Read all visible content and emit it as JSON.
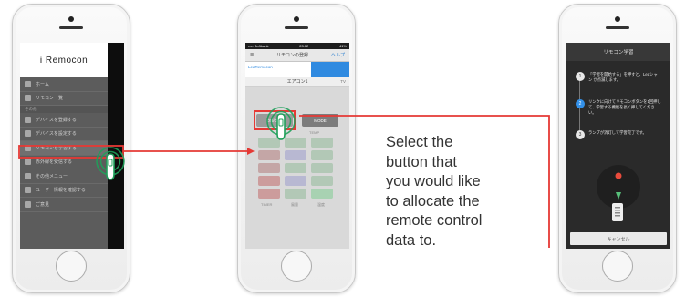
{
  "colors": {
    "arrow": "#e53935",
    "finger": "#1fa05a",
    "accent_blue": "#2f8ae0"
  },
  "phone1": {
    "app_logo": "i Remocon",
    "menu_items": [
      {
        "label": "ホーム",
        "icon": "house-icon"
      },
      {
        "label": "リモコン一覧",
        "icon": "list-icon"
      },
      {
        "label": "デバイスを登録する",
        "icon": "register-icon"
      },
      {
        "label": "デバイスを設定する",
        "icon": "settings-icon"
      },
      {
        "label": "リモコンを学習する",
        "icon": "learn-icon"
      },
      {
        "label": "赤外線を受信する",
        "icon": "receive-icon"
      },
      {
        "label": "その他メニュー",
        "icon": "search-icon"
      },
      {
        "label": "ユーザー情報を確認する",
        "icon": "user-icon"
      },
      {
        "label": "ご意見",
        "icon": "mail-icon"
      }
    ],
    "section_label": "その他"
  },
  "phone2": {
    "status_left": "•••• Softbank",
    "status_time": "23:02",
    "status_right": "41%",
    "nav_title": "リモコンの登録",
    "nav_help": "ヘルプ",
    "tab_label": "LeaRemocon",
    "device_name": "エアコン1",
    "device_type": "TV",
    "button_on": "ON/OFF",
    "button_off": "MODE",
    "temp_label": "TEMP",
    "footer_labels": [
      "TIMER",
      "風量",
      "温度"
    ]
  },
  "phone3": {
    "dialog_title": "リモコン学習",
    "steps": [
      {
        "num": "1",
        "text": "「学習を開始する」を押すと、Leaシャン が点滅します。"
      },
      {
        "num": "2",
        "text": "リンクに向けてリモコンボタンを1回押して、学習する機能を長く押してください。"
      },
      {
        "num": "3",
        "text": "ランプが消灯して学習完了です。"
      }
    ],
    "cancel_label": "キャンセル"
  },
  "caption": {
    "lines": [
      "Select the",
      "button that",
      "you would like",
      "to allocate the",
      "remote control",
      "data to."
    ]
  }
}
